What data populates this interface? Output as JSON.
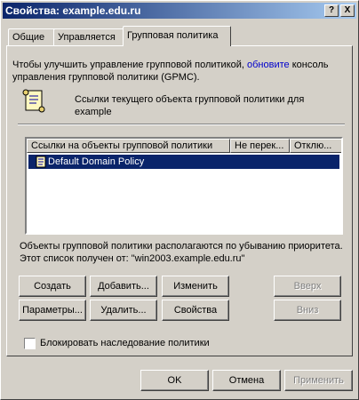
{
  "window": {
    "title": "Свойства: example.edu.ru"
  },
  "title_buttons": {
    "help": "?",
    "close": "X"
  },
  "tabs": [
    "Общие",
    "Управляется",
    "Групповая политика"
  ],
  "info": {
    "line1_pre": "Чтобы улучшить управление групповой политикой, ",
    "line1_link": "обновите",
    "line1_post": " консоль",
    "line2": "управления групповой политики (GPMC).",
    "links_label_1": "Ссылки текущего объекта групповой политики для",
    "links_label_2": "example",
    "policy_icon": "scroll-icon"
  },
  "list": {
    "columns": [
      "Ссылки на объекты групповой политики",
      "Не перек...",
      "Отклю..."
    ],
    "rows": [
      {
        "name": "Default Domain Policy",
        "icon": "gpo-scroll-icon"
      }
    ]
  },
  "order_text": "Объекты групповой политики располагаются по убыванию приоритета.",
  "source_text": "Этот список получен от: \"win2003.example.edu.ru\"",
  "buttons": {
    "create": "Создать",
    "add": "Добавить...",
    "edit": "Изменить",
    "up": "Вверх",
    "options": "Параметры...",
    "delete": "Удалить...",
    "properties": "Свойства",
    "down": "Вниз"
  },
  "block_inheritance": {
    "label": "Блокировать наследование политики",
    "checked": false
  },
  "footer": {
    "ok": "OK",
    "cancel": "Отмена",
    "apply": "Применить"
  }
}
